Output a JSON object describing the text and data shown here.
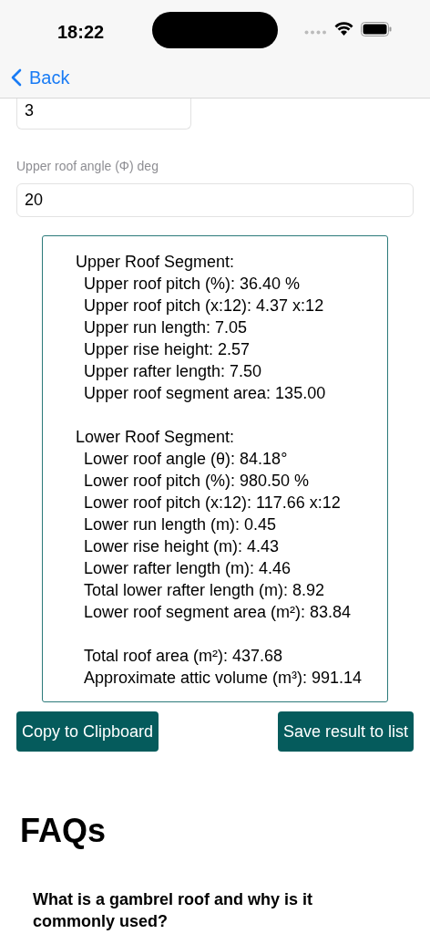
{
  "status_bar": {
    "time": "18:22"
  },
  "nav": {
    "back": "Back"
  },
  "fields": [
    {
      "value": "3"
    },
    {
      "label": "Upper roof angle (Φ)  deg",
      "value": "20"
    }
  ],
  "result": {
    "lines": [
      {
        "kind": "heading",
        "text": "Upper Roof Segment:"
      },
      {
        "kind": "item",
        "text": "Upper roof pitch (%): 36.40 %"
      },
      {
        "kind": "item",
        "text": "Upper roof pitch (x:12): 4.37 x:12"
      },
      {
        "kind": "item",
        "text": "Upper run length: 7.05"
      },
      {
        "kind": "item",
        "text": "Upper rise height: 2.57"
      },
      {
        "kind": "item",
        "text": "Upper rafter length: 7.50"
      },
      {
        "kind": "item",
        "text": "Upper roof segment area: 135.00"
      },
      {
        "kind": "blank"
      },
      {
        "kind": "heading",
        "text": "Lower Roof Segment:"
      },
      {
        "kind": "item",
        "text": "Lower roof angle (θ): 84.18°"
      },
      {
        "kind": "item",
        "text": "Lower roof pitch (%): 980.50 %"
      },
      {
        "kind": "item",
        "text": "Lower roof pitch (x:12): 117.66 x:12"
      },
      {
        "kind": "item",
        "text": "Lower run length (m): 0.45"
      },
      {
        "kind": "item",
        "text": "Lower rise height (m): 4.43"
      },
      {
        "kind": "item",
        "text": "Lower rafter length (m): 4.46"
      },
      {
        "kind": "item",
        "text": "Total lower rafter length (m): 8.92"
      },
      {
        "kind": "item",
        "text": "Lower roof segment area (m²): 83.84"
      },
      {
        "kind": "blank"
      },
      {
        "kind": "item",
        "text": "Total roof area (m²): 437.68"
      },
      {
        "kind": "item",
        "text": "Approximate attic volume (m³): 991.14"
      }
    ]
  },
  "buttons": [
    "Copy to Clipboard",
    "Save result to list"
  ],
  "faqs": {
    "title": "FAQs",
    "questions": [
      "What is a gambrel roof and why is it commonly used?"
    ]
  }
}
